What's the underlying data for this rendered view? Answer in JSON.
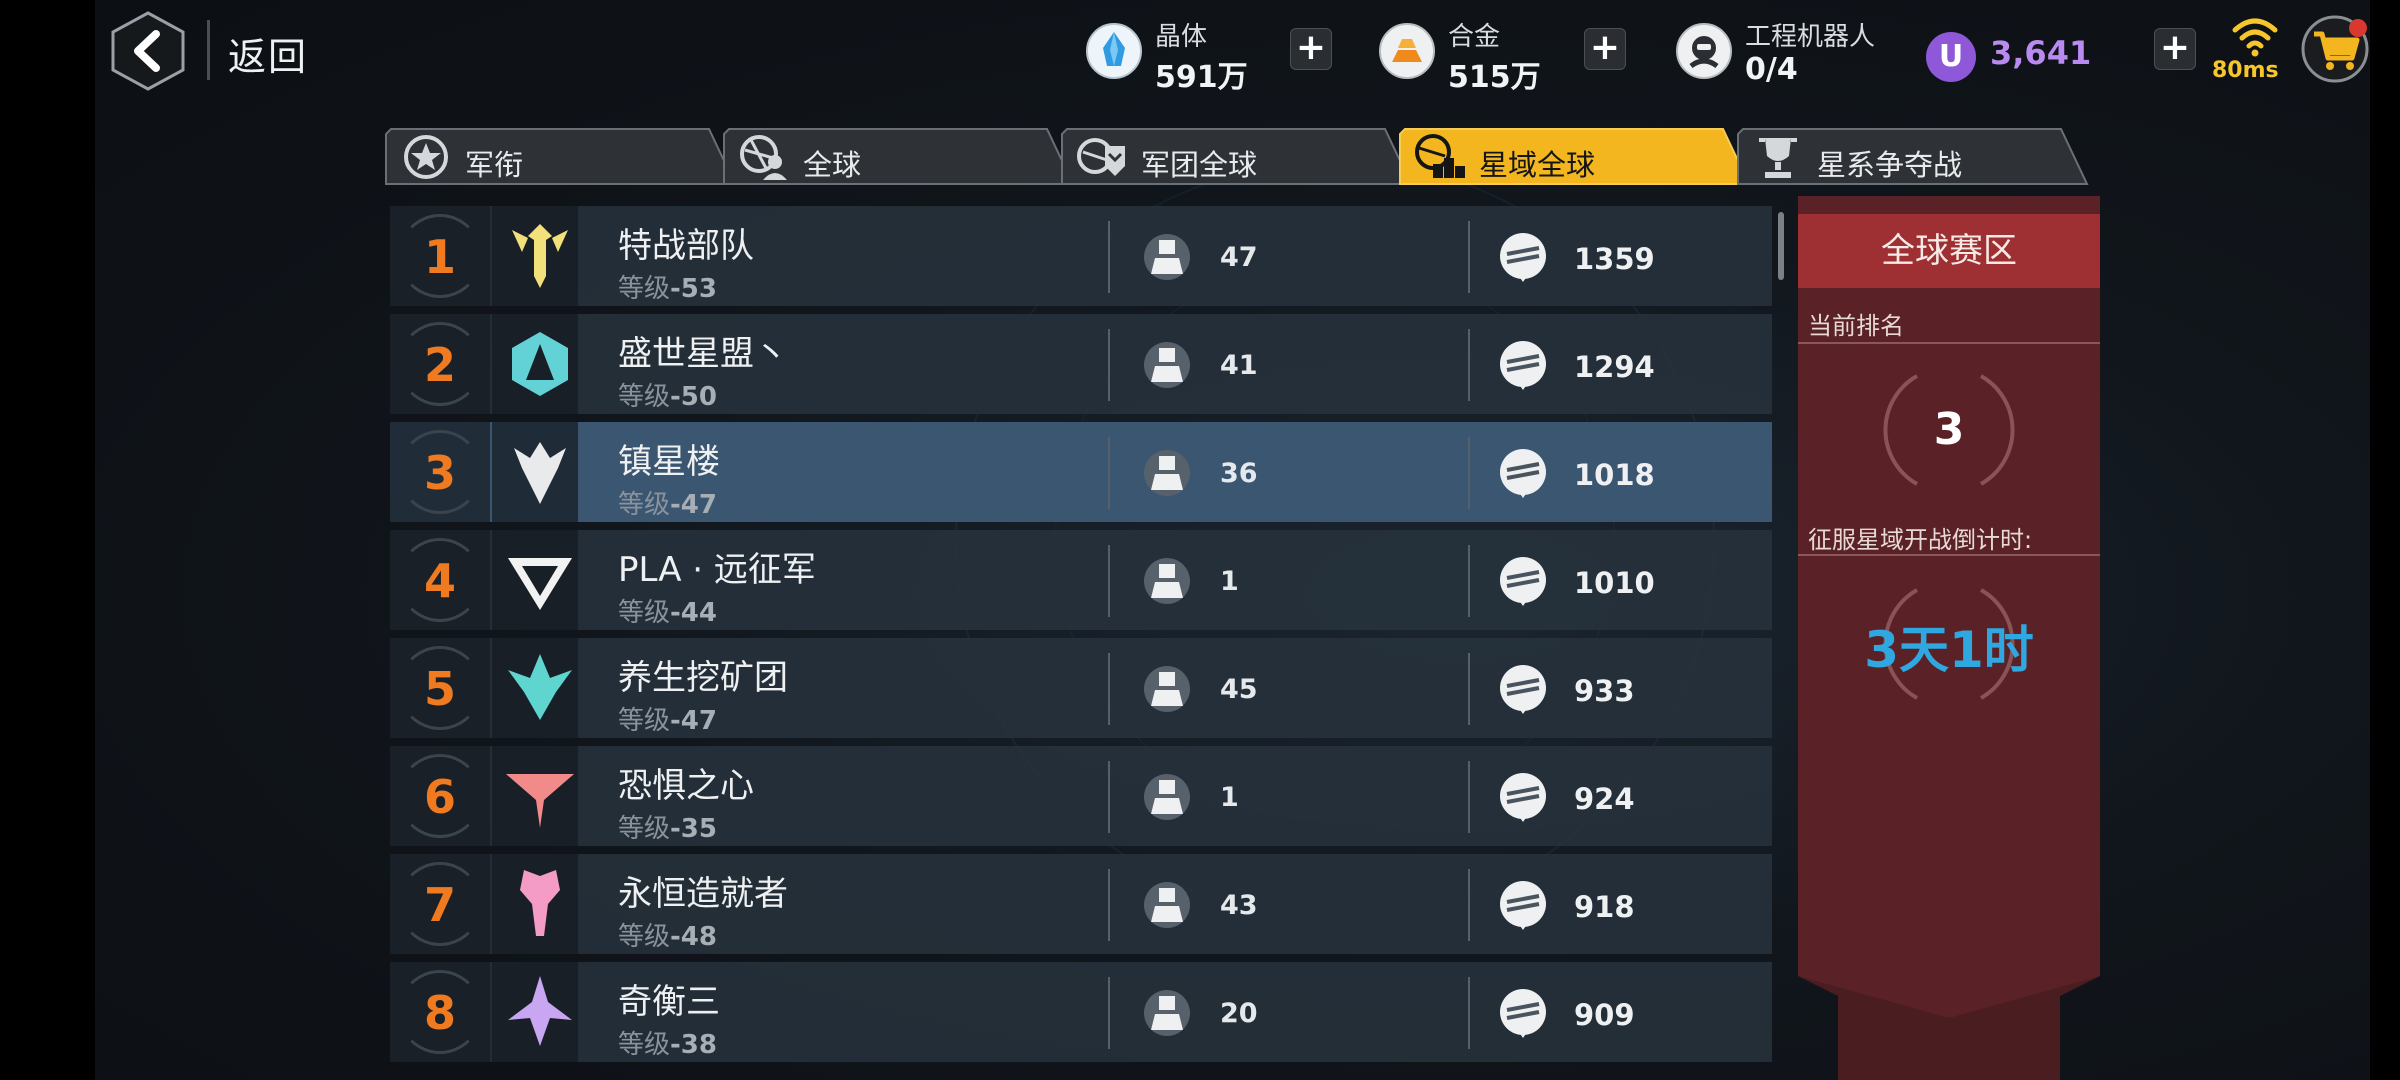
{
  "header": {
    "back_label": "返回",
    "resources": [
      {
        "name": "晶体",
        "value": "591万"
      },
      {
        "name": "合金",
        "value": "515万"
      },
      {
        "name": "工程机器人",
        "value": "0/4"
      }
    ],
    "premium_currency": {
      "icon_letter": "U",
      "value": "3,641"
    },
    "ping": "80ms"
  },
  "tabs": [
    {
      "label": "军衔",
      "icon": "rank-badge-icon",
      "active": false
    },
    {
      "label": "全球",
      "icon": "globe-user-icon",
      "active": false
    },
    {
      "label": "军团全球",
      "icon": "legion-globe-icon",
      "active": false
    },
    {
      "label": "星域全球",
      "icon": "podium-globe-icon",
      "active": true
    },
    {
      "label": "星系争夺战",
      "icon": "trophy-icon",
      "active": false
    }
  ],
  "ranking": [
    {
      "rank": "1",
      "name": "特战部队",
      "level_prefix": "等级",
      "level": "-53",
      "members": "47",
      "points": "1359",
      "emblem_color": "#f2e07a"
    },
    {
      "rank": "2",
      "name": "盛世星盟丶",
      "level_prefix": "等级",
      "level": "-50",
      "members": "41",
      "points": "1294",
      "emblem_color": "#62d2d6"
    },
    {
      "rank": "3",
      "name": "镇星楼",
      "level_prefix": "等级",
      "level": "-47",
      "members": "36",
      "points": "1018",
      "emblem_color": "#e8eaec",
      "highlight": true
    },
    {
      "rank": "4",
      "name": "PLA · 远征军",
      "level_prefix": "等级",
      "level": "-44",
      "members": "1",
      "points": "1010",
      "emblem_color": "#f2f2f2"
    },
    {
      "rank": "5",
      "name": "养生挖矿团",
      "level_prefix": "等级",
      "level": "-47",
      "members": "45",
      "points": "933",
      "emblem_color": "#5fd5cf"
    },
    {
      "rank": "6",
      "name": "恐惧之心",
      "level_prefix": "等级",
      "level": "-35",
      "members": "1",
      "points": "924",
      "emblem_color": "#f28a8a"
    },
    {
      "rank": "7",
      "name": "永恒造就者",
      "level_prefix": "等级",
      "level": "-48",
      "members": "43",
      "points": "918",
      "emblem_color": "#f49bc6"
    },
    {
      "rank": "8",
      "name": "奇衡三",
      "level_prefix": "等级",
      "level": "-38",
      "members": "20",
      "points": "909",
      "emblem_color": "#c9a6f2"
    }
  ],
  "panel": {
    "title": "全球赛区",
    "current_rank_label": "当前排名",
    "current_rank": "3",
    "countdown_label": "征服星域开战倒计时:",
    "countdown": "3天1时"
  },
  "colors": {
    "accent_tab": "#f3b61f",
    "rank_orange": "#f07a1f",
    "panel_red": "#9e2f32",
    "countdown_blue": "#2fa8e2",
    "premium_purple": "#b98af0"
  }
}
